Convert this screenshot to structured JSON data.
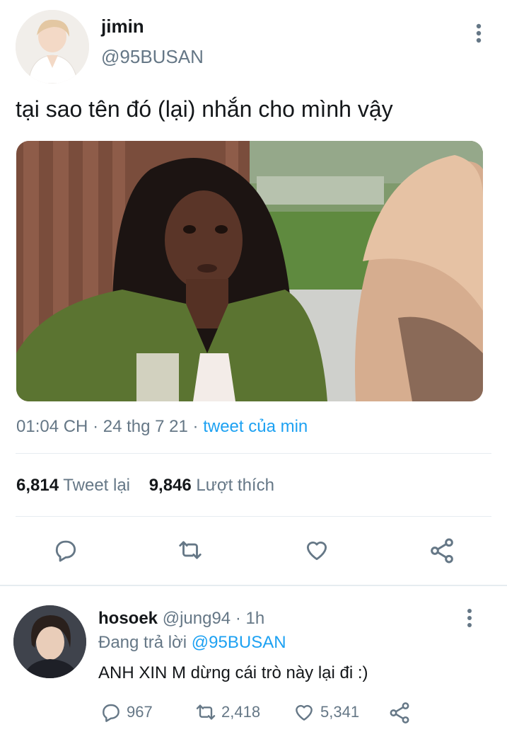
{
  "tweet": {
    "author": {
      "name": "jimin",
      "handle": "@95BUSAN"
    },
    "text": "tại sao tên đó (lại) nhắn cho mình vậy",
    "meta": {
      "time": "01:04 CH",
      "date": "24 thg 7 21",
      "separator": "·",
      "source": "tweet của min"
    },
    "stats": {
      "retweets": "6,814",
      "retweets_label": "Tweet lại",
      "likes": "9,846",
      "likes_label": "Lượt thích"
    },
    "icons": [
      "reply-icon",
      "retweet-icon",
      "like-icon",
      "share-icon",
      "more-icon"
    ]
  },
  "reply": {
    "author": {
      "name": "hosoek",
      "handle": "@jung94",
      "separator": "·",
      "time": "1h"
    },
    "replying_label": "Đang trả lời",
    "replying_to": "@95BUSAN",
    "text": "ANH XIN M dừng cái trò này lại đi :)",
    "counts": {
      "replies": "967",
      "retweets": "2,418",
      "likes": "5,341"
    }
  },
  "colors": {
    "link": "#1da1f2",
    "secondary_text": "#657786",
    "divider": "#e6ecf0"
  }
}
